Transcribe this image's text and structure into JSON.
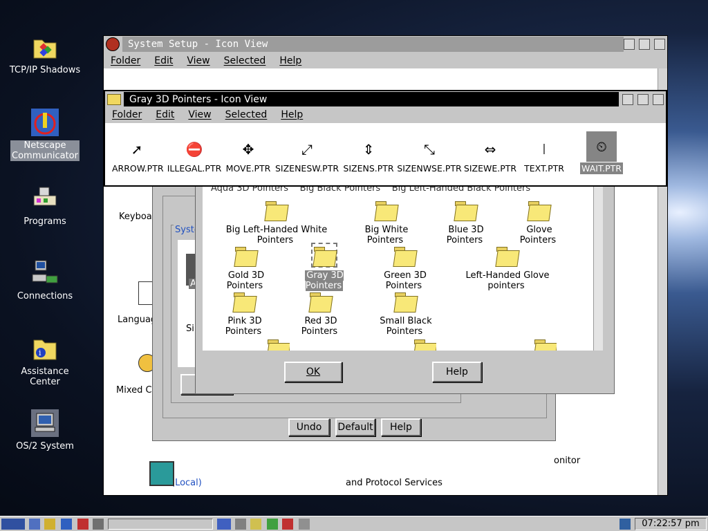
{
  "desktop_icons": [
    {
      "label": "TCP/IP Shadows",
      "icon": "folder-color-icon"
    },
    {
      "label": "Netscape\nCommunicator",
      "icon": "netscape-icon"
    },
    {
      "label": "Programs",
      "icon": "programs-icon"
    },
    {
      "label": "Connections",
      "icon": "connections-icon"
    },
    {
      "label": "Assistance Center",
      "icon": "assistance-icon"
    },
    {
      "label": "OS/2 System",
      "icon": "os2-system-icon"
    }
  ],
  "system_setup": {
    "title": "System Setup - Icon View",
    "menu": [
      "Folder",
      "Edit",
      "View",
      "Selected",
      "Help"
    ],
    "partial_labels": {
      "keyboard": "Keyboa",
      "language": "Languag",
      "mixed": "Mixed Co",
      "monitor": "onitor",
      "local": "(Local)",
      "protocol": "and Protocol Services",
      "system": "Syste",
      "a": "A",
      "si": "Si"
    }
  },
  "gray_window": {
    "title": "Gray 3D Pointers - Icon View",
    "menu": [
      "Folder",
      "Edit",
      "View",
      "Selected",
      "Help"
    ],
    "pointers": [
      {
        "label": "ARROW.PTR",
        "glyph": "➚"
      },
      {
        "label": "ILLEGAL.PTR",
        "glyph": "⛔"
      },
      {
        "label": "MOVE.PTR",
        "glyph": "✥"
      },
      {
        "label": "SIZENESW.PTR",
        "glyph": "⤢"
      },
      {
        "label": "SIZENS.PTR",
        "glyph": "⇕"
      },
      {
        "label": "SIZENWSE.PTR",
        "glyph": "⤡"
      },
      {
        "label": "SIZEWE.PTR",
        "glyph": "⇔"
      },
      {
        "label": "TEXT.PTR",
        "glyph": "I"
      },
      {
        "label": "WAIT.PTR",
        "glyph": "⏲"
      }
    ]
  },
  "pointer_dialog": {
    "partial_top": [
      "Aqua 3D Pointers",
      "Big Black Pointers",
      "Big Left-Handed Black Pointers"
    ],
    "folders": [
      "Big Left-Handed White Pointers",
      "Big White Pointers",
      "Blue 3D Pointers",
      "Glove Pointers",
      "Gold 3D Pointers",
      "Gray 3D Pointers",
      "Green 3D Pointers",
      "Left-Handed Glove pointers",
      "Pink 3D Pointers",
      "Red 3D Pointers",
      "Small Black Pointers"
    ],
    "ok": "OK",
    "help": "Help"
  },
  "notebook_buttons": {
    "undo": "Undo",
    "default": "Default",
    "help": "Help"
  },
  "taskbar": {
    "time": "07:22:57 pm"
  }
}
